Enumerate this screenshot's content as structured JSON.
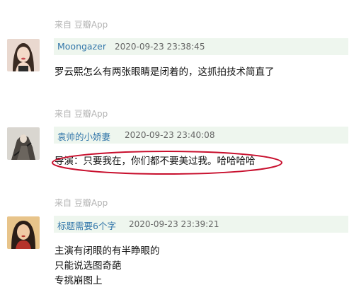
{
  "comments": [
    {
      "source": "来自 豆瓣App",
      "author": "Moongazer",
      "time": "2020-09-23 23:38:45",
      "lines": [
        "罗云熙怎么有两张眼睛是闭着的，这抓拍技术简直了"
      ]
    },
    {
      "source": "来自 豆瓣App",
      "author": "袁帅的小娇妻",
      "time": "2020-09-23 23:40:08",
      "lines": [
        "导演：只要我在，你们都不要美过我。哈哈哈哈"
      ]
    },
    {
      "source": "来自 豆瓣App",
      "author": "标题需要6个字",
      "time": "2020-09-23 23:39:21",
      "lines": [
        "主演有闭眼的有半睁眼的",
        "只能说选图奇葩",
        "专挑崩图上"
      ]
    }
  ],
  "colors": {
    "author_link": "#3377aa",
    "meta_bar_bg": "#eef6ee",
    "highlight_ellipse": "#c8102e"
  }
}
